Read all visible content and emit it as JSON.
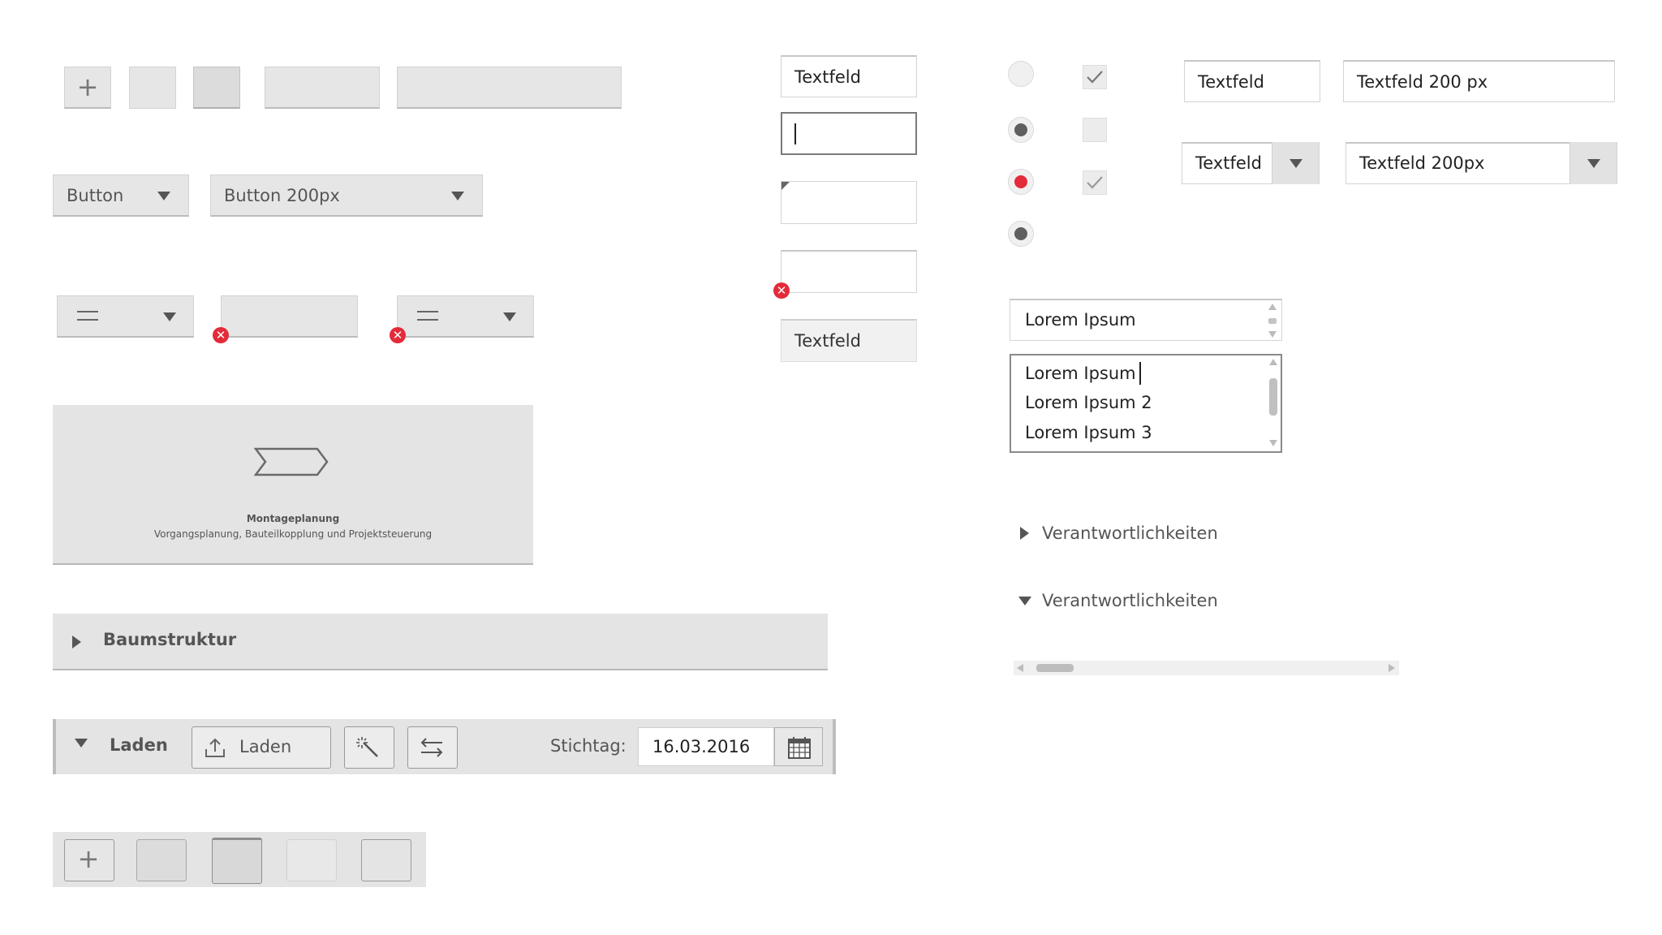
{
  "buttons": {
    "plus_symbol": "+",
    "dropdown_button_label": "Button",
    "dropdown_button_200_label": "Button 200px",
    "menu_symbol": "═"
  },
  "tile": {
    "title": "Montageplanung",
    "subtitle": "Vorgangsplanung, Bauteilkopplung und Projektsteuerung"
  },
  "tree": {
    "label": "Baumstruktur"
  },
  "toolbar": {
    "title": "Laden",
    "load_button_label": "Laden",
    "date_label": "Stichtag:",
    "date_value": "16.03.2016"
  },
  "textfields": {
    "default_value": "Textfeld",
    "readonly_value": "Textfeld"
  },
  "right_fields": {
    "text_1": "Textfeld",
    "text_200": "Textfeld 200 px",
    "combo_1": "Textfeld",
    "combo_200": "Textfeld 200px"
  },
  "listbox_single": {
    "value": "Lorem Ipsum"
  },
  "listbox_multi": {
    "items": [
      "Lorem Ipsum",
      "Lorem Ipsum 2",
      "Lorem Ipsum 3"
    ]
  },
  "accordion": {
    "collapsed_label": "Verantwortlichkeiten",
    "expanded_label": "Verantwortlichkeiten"
  },
  "colors": {
    "error": "#e32b3a",
    "radio_selected": "#5f5f5f",
    "radio_error": "#e32b3a"
  }
}
